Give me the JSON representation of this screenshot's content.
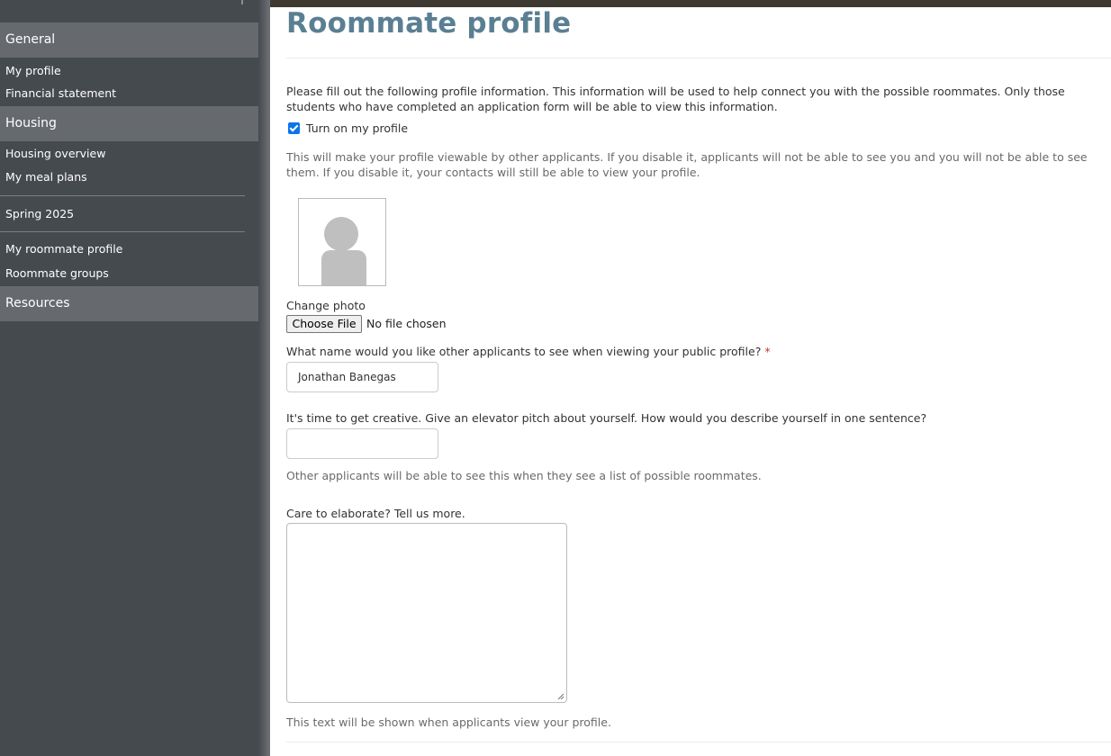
{
  "sidebar": {
    "sections": [
      {
        "label": "General"
      },
      {
        "label": "Housing"
      },
      {
        "label": "Resources"
      }
    ],
    "general_items": [
      "My profile",
      "Financial statement"
    ],
    "housing_items": [
      "Housing overview",
      "My meal plans"
    ],
    "term_label": "Spring 2025",
    "roommate_items": [
      "My roommate profile",
      "Roommate groups"
    ]
  },
  "page": {
    "title": "Roommate profile",
    "intro": "Please fill out the following profile information. This information will be used to help connect you with the possible roommates. Only those students who have completed an application form will be able to view this information.",
    "toggle_label": "Turn on my profile",
    "toggle_checked": true,
    "toggle_help": "This will make your profile viewable by other applicants. If you disable it, applicants will not be able to see you and you will not be able to see them. If you disable it, your contacts will still be able to view your profile.",
    "photo_label": "Change photo",
    "file_button": "Choose File",
    "file_status": "No file chosen",
    "name_question": "What name would you like other applicants to see when viewing your public profile?",
    "required_mark": "*",
    "name_value": "Jonathan Banegas",
    "pitch_question": "It's time to get creative. Give an elevator pitch about yourself. How would you describe yourself in one sentence?",
    "pitch_value": "",
    "pitch_help": "Other applicants will be able to see this when they see a list of possible roommates.",
    "elaborate_label": "Care to elaborate? Tell us more.",
    "elaborate_value": "",
    "elaborate_help": "This text will be shown when applicants view your profile."
  },
  "colors": {
    "sidebar_bg": "#454a4f",
    "sidebar_header_bg": "#666a6e",
    "title_color": "#5a7f93",
    "checkbox_accent": "#0a75e8",
    "required_color": "#c0392b"
  }
}
